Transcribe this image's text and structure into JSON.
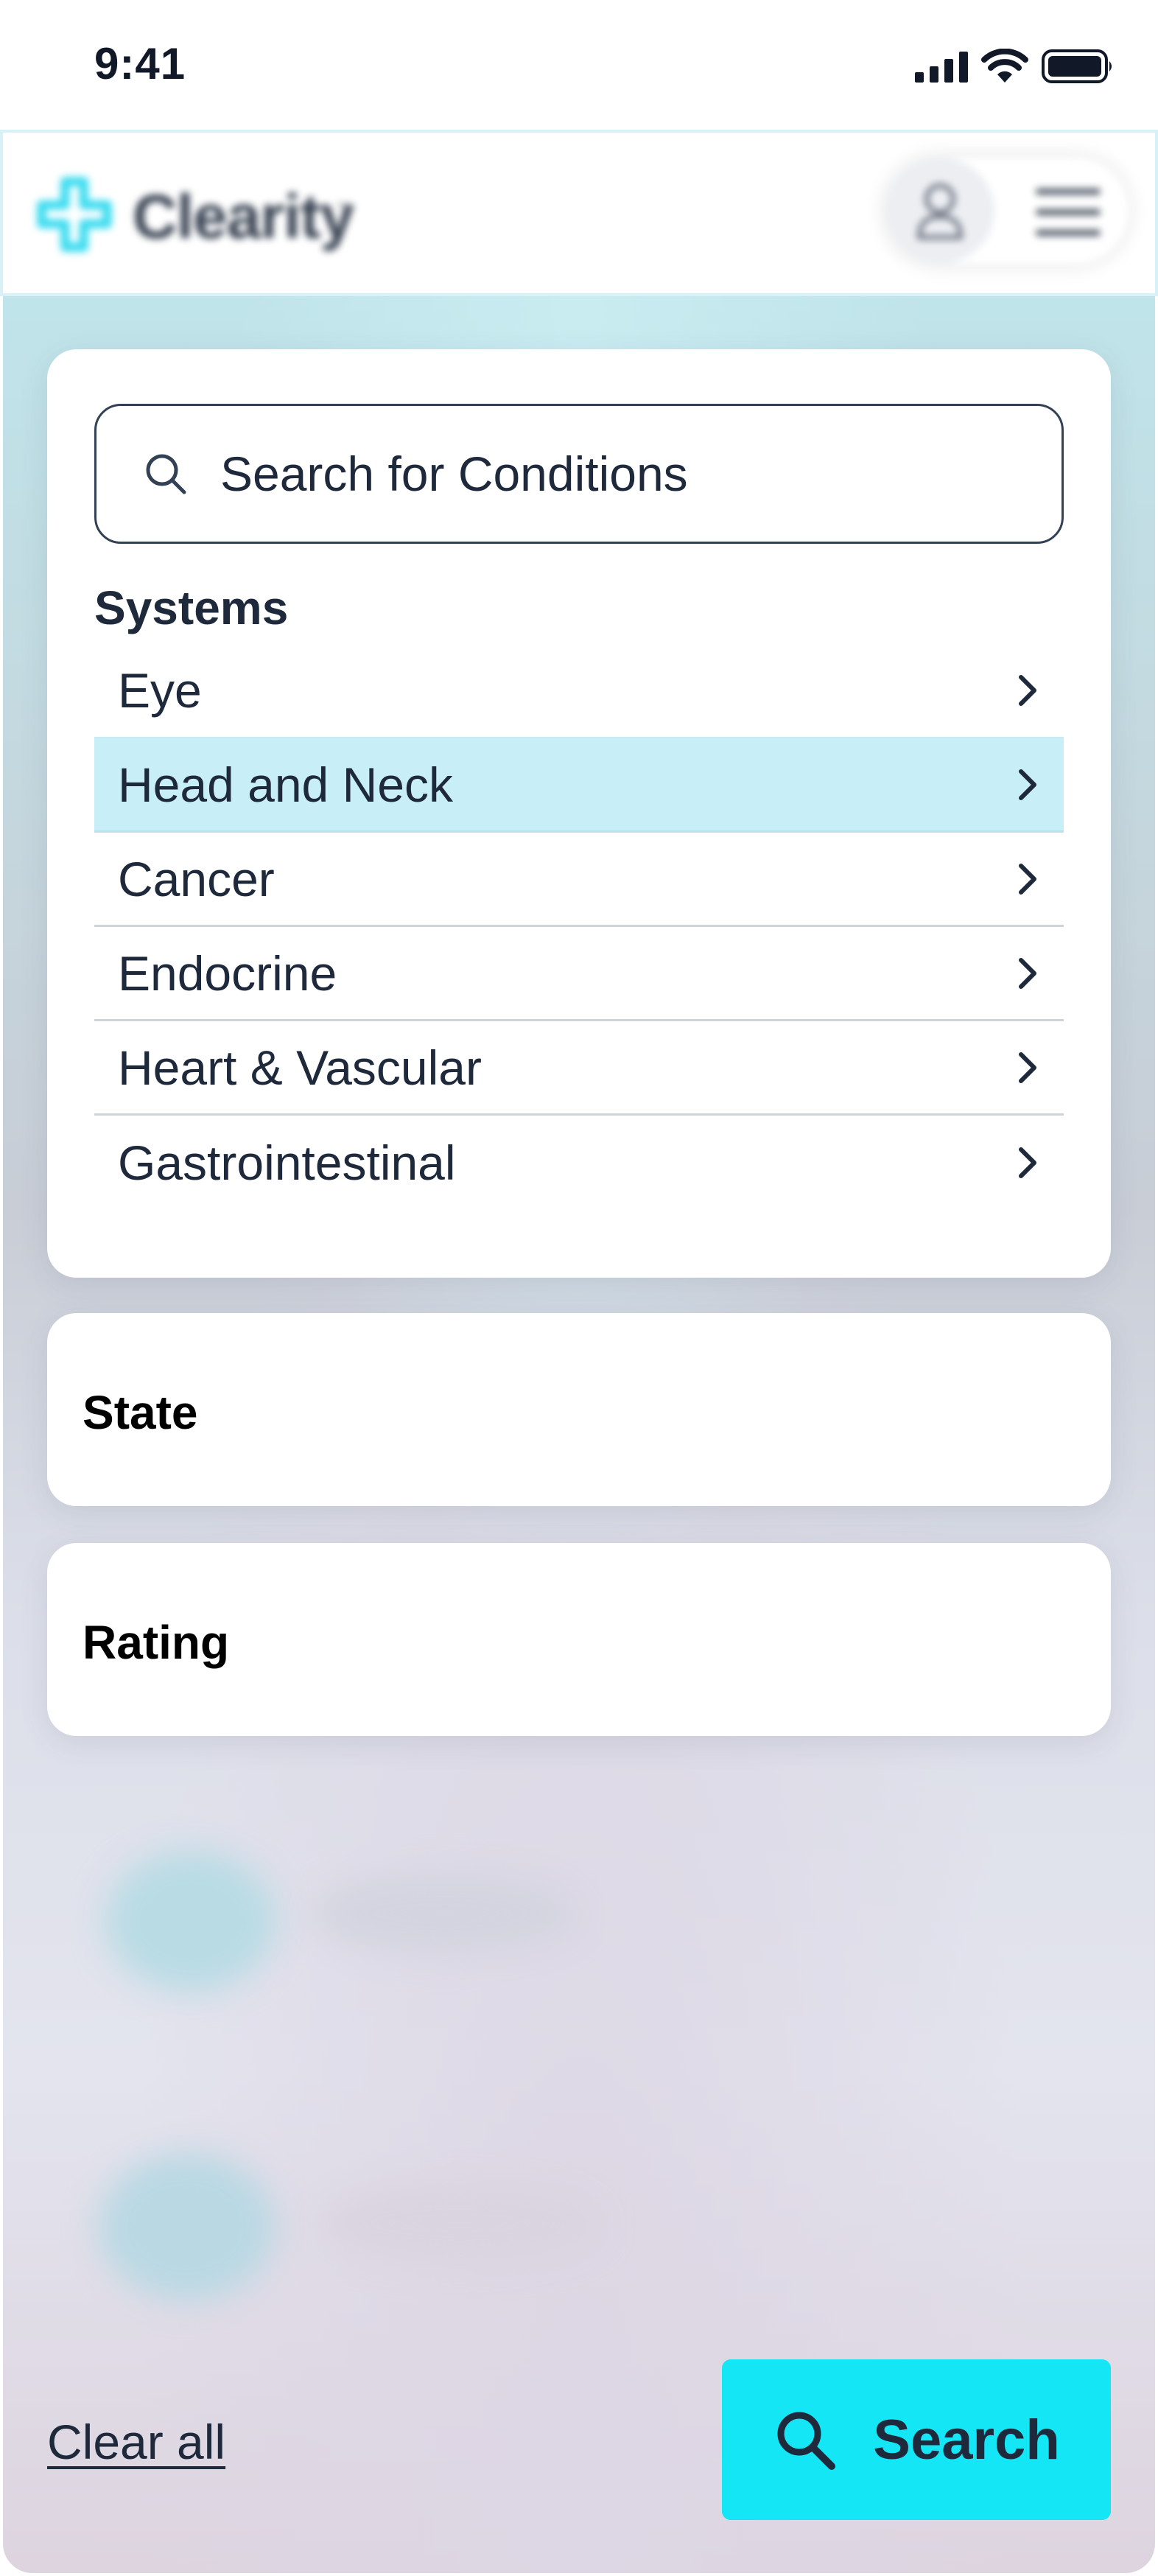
{
  "status_bar": {
    "time": "9:41"
  },
  "header": {
    "brand": "Clearity",
    "trademark": "™"
  },
  "search": {
    "placeholder": "Search for Conditions"
  },
  "systems": {
    "title": "Systems",
    "items": [
      {
        "label": "Eye",
        "selected": false
      },
      {
        "label": "Head and Neck",
        "selected": true
      },
      {
        "label": "Cancer",
        "selected": false
      },
      {
        "label": "Endocrine",
        "selected": false
      },
      {
        "label": "Heart & Vascular",
        "selected": false
      },
      {
        "label": "Gastrointestinal",
        "selected": false
      }
    ]
  },
  "state_section": {
    "label": "State"
  },
  "rating_section": {
    "label": "Rating"
  },
  "footer": {
    "clear_label": "Clear all",
    "search_label": "Search"
  },
  "colors": {
    "accent": "#14e6f5",
    "selected_row": "#c8eef8",
    "text": "#1e293b",
    "logo": "#3ddcf0"
  }
}
